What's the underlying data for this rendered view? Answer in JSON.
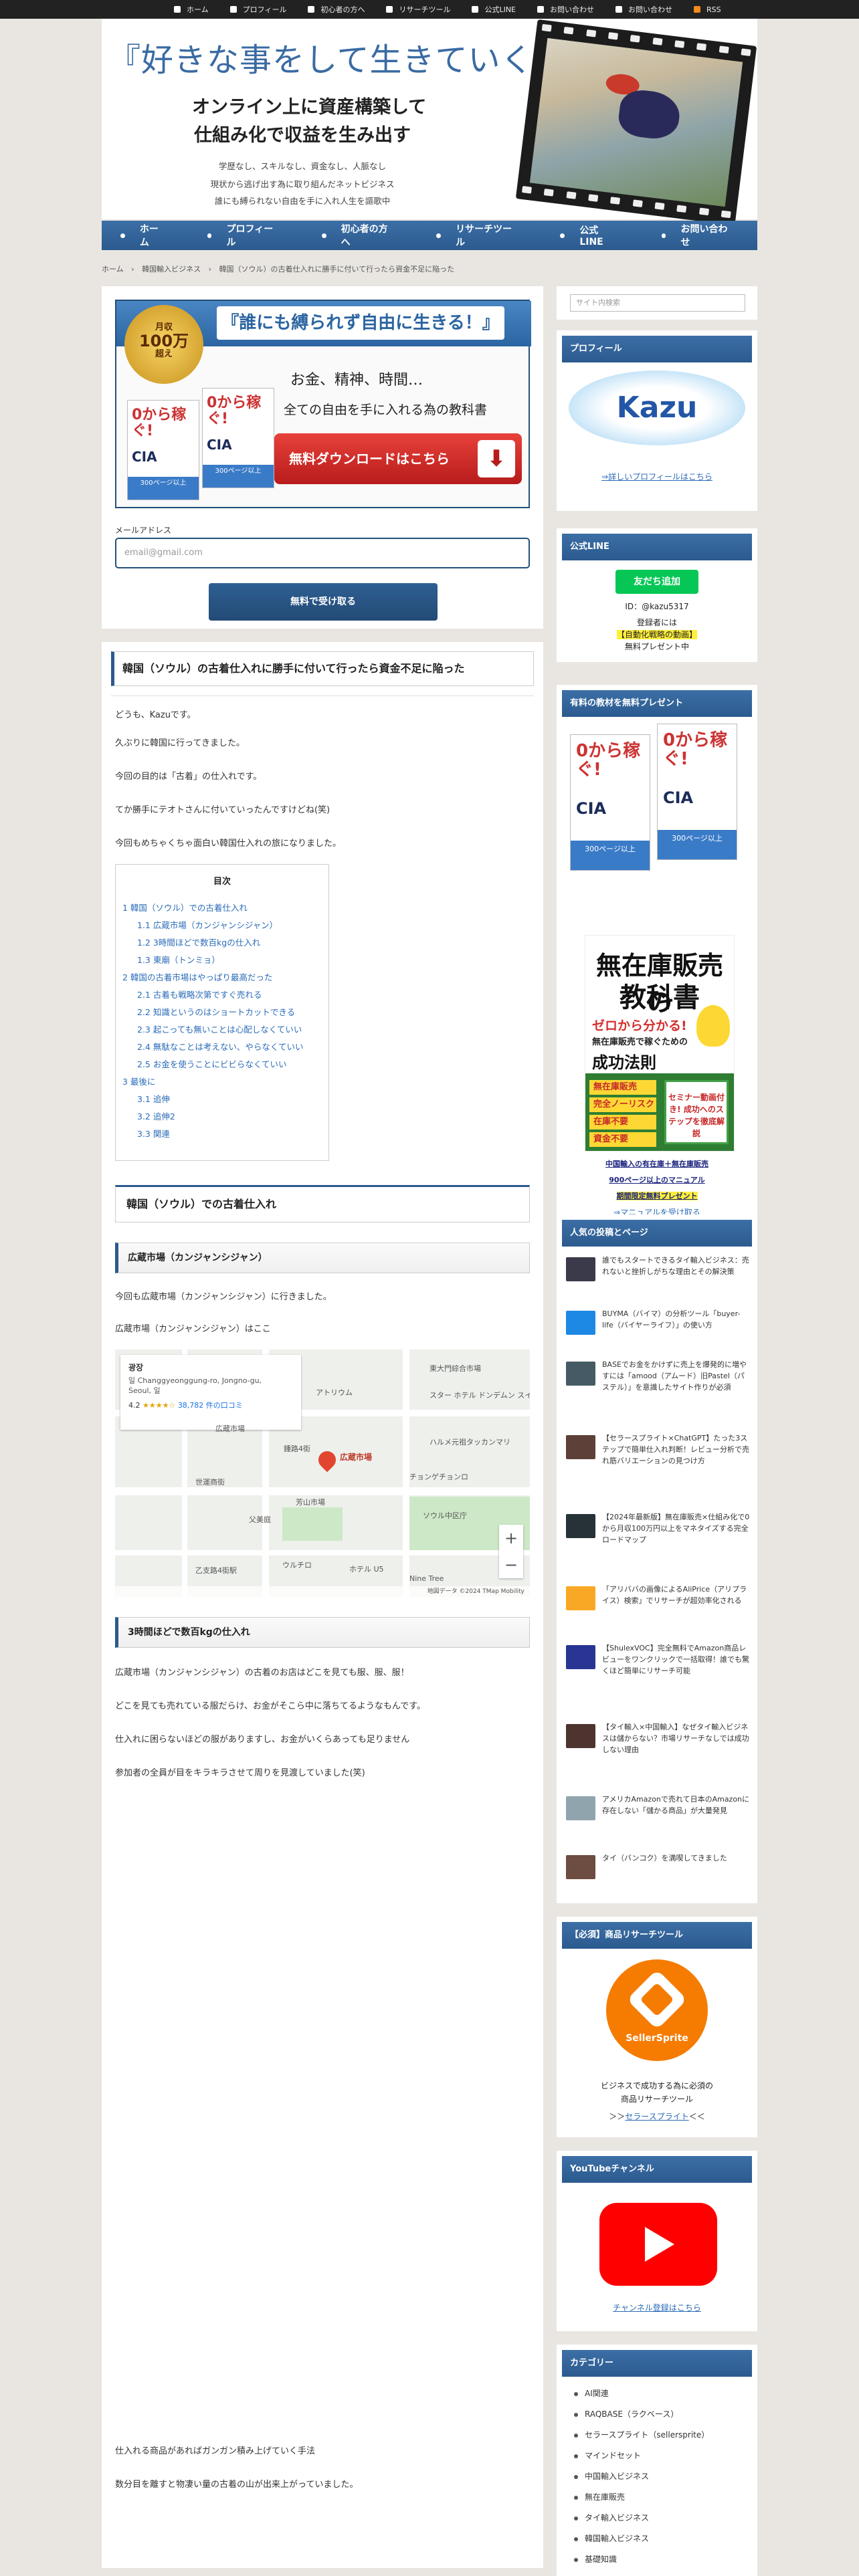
{
  "topnav": [
    "ホーム",
    "プロフィール",
    "初心者の方へ",
    "リサーチツール",
    "公式LINE",
    "お問い合わせ",
    "お問い合わせ",
    "RSS"
  ],
  "header": {
    "title": "『好きな事をして生きていく』",
    "sub1": "オンライン上に資産構築して",
    "sub2": "仕組み化で収益を生み出す",
    "p1": "学歴なし、スキルなし、資金なし、人脈なし",
    "p2": "現状から逃げ出す為に取り組んだネットビジネス",
    "p3": "誰にも縛られない自由を手に入れ人生を謳歌中"
  },
  "mainnav": [
    "ホーム",
    "プロフィール",
    "初心者の方へ",
    "リサーチツール",
    "公式LINE",
    "お問い合わせ"
  ],
  "breadcrumb": [
    "ホーム",
    "›",
    "韓国輸入ビジネス",
    "›",
    "韓国（ソウル）の古着仕入れに勝手に付いて行ったら資金不足に陥った"
  ],
  "optin": {
    "medal_line1": "月収",
    "medal_big": "100万",
    "medal_line2": "超え",
    "ribbon": "『誰にも縛られず自由に生きる！』",
    "book_title": "0から稼ぐ!",
    "book_code": "CIA",
    "book_band": "300ページ以上",
    "line1": "お金、精神、時間…",
    "line2": "全ての自由を手に入れる為の教科書",
    "download": "無料ダウンロードはこちら",
    "email_label": "メールアドレス",
    "email_placeholder": "email@gmail.com",
    "submit": "無料で受け取る"
  },
  "article": {
    "title": "韓国（ソウル）の古着仕入れに勝手に付いて行ったら資金不足に陥った",
    "intro": [
      "どうも、Kazuです。",
      "久ぶりに韓国に行ってきました。",
      "今回の目的は「古着」の仕入れです。",
      "てか勝手にテオトさんに付いていったんですけどね(笑)",
      "今回もめちゃくちゃ面白い韓国仕入れの旅になりました。"
    ],
    "toc_title": "目次",
    "toc": [
      "1 韓国（ソウル）での古着仕入れ",
      "1.1 広蔵市場（カンジャンシジャン）",
      "1.2 3時間ほどで数百kgの仕入れ",
      "1.3 東廟（トンミョ）",
      "2 韓国の古着市場はやっぱり最高だった",
      "2.1 古着も戦略次第ですぐ売れる",
      "2.2 知識というのはショートカットできる",
      "2.3 起こっても無いことは心配しなくていい",
      "2.4 無駄なことは考えない、やらなくていい",
      "2.5 お金を使うことにビビらなくていい",
      "3 最後に",
      "3.1 追伸",
      "3.2 追伸2",
      "3.3 関連"
    ],
    "h2_1": "韓国（ソウル）での古着仕入れ",
    "h3_1": "広蔵市場（カンジャンシジャン）",
    "s1_p1": "今回も広蔵市場（カンジャンシジャン）に行きました。",
    "s1_p2": "広蔵市場（カンジャンシジャン）はここ",
    "map": {
      "name": "광장",
      "address1": "일 Changgyeonggung-ro, Jongno-gu,",
      "address2": "Seoul, 일",
      "rating": "4.2",
      "stars": "★★★★☆",
      "reviews": "38,782 件の口コミ",
      "pin_label": "広蔵市場",
      "labels": [
        "アトリウム",
        "スター ホテル ドンデムン スイート",
        "東大門綜合市場",
        "鍾路4街",
        "広蔵市場",
        "チョンゲチョンロ",
        "世運商街",
        "芳山市場",
        "父美庭",
        "ハルメ元祖タッカンマリ",
        "ソウル中区庁",
        "ホテル U5",
        "乙支路4街駅",
        "ウルチロ",
        "Nine Tree"
      ],
      "footer": "地図データ ©2024 TMap Mobility"
    },
    "h3_2": "3時間ほどで数百kgの仕入れ",
    "s2": [
      "広蔵市場（カンジャンシジャン）の古着のお店はどこを見ても服、服、服！",
      "どこを見ても売れている服だらけ、お金がそこら中に落ちてるようなもんです。",
      "仕入れに困らないほどの服がありますし、お金がいくらあっても足りません",
      "参加者の全員が目をキラキラさせて周りを見渡していました(笑)"
    ],
    "s3": [
      "仕入れる商品があればガンガン積み上げていく手法",
      "数分目を離すと物凄い量の古着の山が出来上がっていました。"
    ]
  },
  "sidebar": {
    "search_placeholder": "サイト内検索",
    "profile_h": "プロフィール",
    "profile_logo": "Kazu",
    "profile_link": "⇒詳しいプロフィールはこちら",
    "line_h": "公式LINE",
    "line_btn": "友だち追加",
    "line_id": "ID：@kazu5317",
    "line_t1": "登録者には",
    "line_t2": "【自動化戦略の動画】",
    "line_t3": "無料プレゼント中",
    "gift_h": "有料の教材を無料プレゼント",
    "gift_book_title": "0から稼ぐ!",
    "gift_book_code": "CIA",
    "gift_book_band": "300ページ以上",
    "muzaiko": {
      "t1": "無在庫販売の",
      "t2": "教科書",
      "t3": "ゼロから分かる!",
      "t4": "無在庫販売で稼ぐための",
      "t5": "成功法則",
      "list": [
        "無在庫販売",
        "完全ノーリスク",
        "在庫不要",
        "資金不要"
      ],
      "badge": "セミナー動画付き! 成功へのステップを徹底解説"
    },
    "gift_l1": "中国輸入の有在庫＋無在庫販売",
    "gift_l2": "900ページ以上のマニュアル",
    "gift_l3": "期間限定無料プレゼント",
    "gift_link": "⇒マニュアルを受け取る",
    "popular_h": "人気の投稿とページ",
    "popular": [
      {
        "t": "誰でもスタートできるタイ輸入ビジネス：売れないと挫折しがちな理由とその解決策",
        "c": "#3a3a4a"
      },
      {
        "t": "BUYMA（バイマ）の分析ツール「buyer-life（バイヤーライフ）」の使い方",
        "c": "#1e88e5"
      },
      {
        "t": "BASEでお金をかけずに売上を爆発的に増やすには「amood（アムード）旧Pastel（パステル）」を意識したサイト作りが必須",
        "c": "#455a64"
      },
      {
        "t": "【セラースプライト×ChatGPT】たった3ステップで簡単仕入れ判断！レビュー分析で売れ筋バリエーションの見つけ方",
        "c": "#5d4037"
      },
      {
        "t": "【2024年最新版】無在庫販売×仕組み化で0から月収100万円以上をマネタイズする完全ロードマップ",
        "c": "#263238"
      },
      {
        "t": "「アリババの画像によるAliPrice（アリプライス）検索」でリサーチが超効率化される",
        "c": "#f9a825"
      },
      {
        "t": "【ShulexVOC】完全無料でAmazon商品レビューをワンクリックで一括取得！誰でも驚くほど簡単にリサーチ可能",
        "c": "#283593"
      },
      {
        "t": "【タイ輸入×中国輸入】なぜタイ輸入ビジネスは儲からない？市場リサーチなしでは成功しない理由",
        "c": "#4e342e"
      },
      {
        "t": "アメリカAmazonで売れて日本のAmazonに存在しない「儲かる商品」が大量発見",
        "c": "#90a4ae"
      },
      {
        "t": "タイ（バンコク）を満喫してきました",
        "c": "#6d4c41"
      }
    ],
    "tool_h": "【必須】商品リサーチツール",
    "tool_logo": "SellerSprite",
    "tool_t1": "ビジネスで成功する為に必須の",
    "tool_t2": "商品リサーチツール",
    "tool_link_pre": "＞＞",
    "tool_link": "セラースプライト",
    "tool_link_post": "＜＜",
    "yt_h": "YouTubeチャンネル",
    "yt_link": "チャンネル登録はこちら",
    "cat_h": "カテゴリー",
    "cats": [
      "AI関連",
      "RAQBASE（ラクベース）",
      "セラースプライト（sellersprite）",
      "マインドセット",
      "中国輸入ビジネス",
      "無在庫販売",
      "タイ輸入ビジネス",
      "韓国輸入ビジネス",
      "基礎知識"
    ]
  }
}
